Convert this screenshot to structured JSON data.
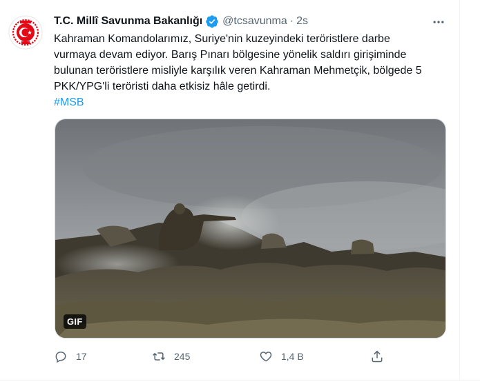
{
  "tweet": {
    "display_name": "T.C. Millî Savunma Bakanlığı",
    "handle": "@tcsavunma",
    "separator": "·",
    "time": "2s",
    "text_lines": [
      "Kahraman Komandolarımız, Suriye'nin kuzeyindeki teröristlere darbe",
      "vurmaya devam ediyor.  Barış Pınarı bölgesine yönelik saldırı girişiminde",
      "bulunan teröristlere misliyle karşılık veren Kahraman Mehmetçik, bölgede 5",
      "PKK/YPG'li teröristi daha etkisiz hâle getirdi."
    ],
    "hashtag": "#MSB",
    "media_badge": "GIF",
    "actions": {
      "reply_count": "17",
      "retweet_count": "245",
      "like_count": "1,4 B",
      "share_count": ""
    }
  },
  "icons": {
    "avatar": "ministry-emblem-icon",
    "verified": "verified-badge-icon",
    "more": "more-horizontal-icon",
    "reply": "reply-icon",
    "retweet": "retweet-icon",
    "like": "heart-icon",
    "share": "share-icon"
  },
  "colors": {
    "accent": "#1d9bf0",
    "emblem_red": "#e30a17",
    "text_primary": "#0f1419",
    "text_secondary": "#536471"
  }
}
